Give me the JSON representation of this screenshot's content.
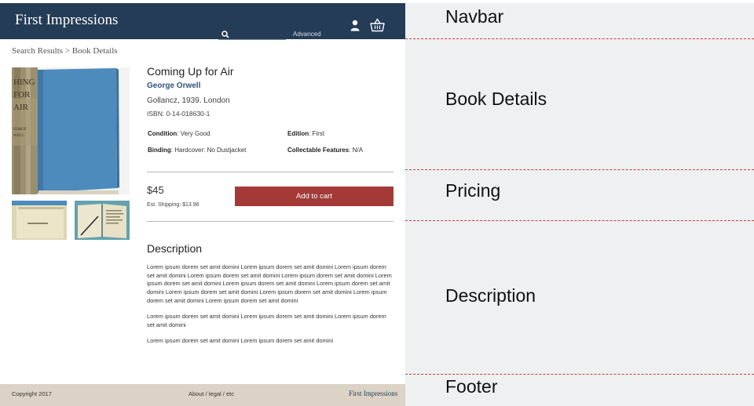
{
  "navbar": {
    "brand": "First Impressions",
    "search_placeholder": "",
    "advanced_label": "Advanced",
    "icons": [
      "search-icon",
      "user-icon",
      "basket-icon"
    ],
    "color": "#243c56"
  },
  "breadcrumb": {
    "parent": "Search Results",
    "separator": " > ",
    "current": "Book Details"
  },
  "book": {
    "title": "Coming Up for Air",
    "author": "George Orwell",
    "publication": "Gollancz, 1939. London",
    "isbn": "ISBN: 0-14-018630-1",
    "attributes": [
      {
        "label": "Condition",
        "value": ": Very Good"
      },
      {
        "label": "Edition",
        "value": ": First"
      },
      {
        "label": "Binding",
        "value": ": Hardcover:  No Dustjacket"
      },
      {
        "label": "Collectable Features",
        "value": ":  N/A"
      }
    ]
  },
  "pricing": {
    "price": "$45",
    "shipping": "Est. Shipping: $13.96",
    "cart_label": "Add to cart",
    "cart_color": "#a33a38"
  },
  "description": {
    "heading": "Description",
    "paragraphs": [
      "Lorem ipsum dorem set amit domini Lorem ipsum dorem set amit domini Lorem ipsum dorem set amit domini Lorem ipsum dorem set amit domini Lorem ipsum dorem set amit domini Lorem ipsum dorem set amit domini Lorem ipsum dorem set amit domini Lorem ipsum dorem set amit domini Lorem ipsum dorem set amit domini Lorem ipsum dorem set amit domini Lorem ipsum dorem set amit domini Lorem ipsum dorem set amit domini",
      "Lorem ipsum dorem set amit domini Lorem ipsum dorem set amit domini Lorem ipsum dorem set amit domini",
      "Lorem ipsum dorem set amit domini Lorem ipsum dorem set amit domini"
    ]
  },
  "footer": {
    "copyright": "Copyright 2017",
    "links": "About / legal / etc",
    "brand": "First Impressions",
    "color": "#dcd3c6"
  },
  "annotations": {
    "navbar": "Navbar",
    "book_details": "Book Details",
    "pricing": "Pricing",
    "description": "Description",
    "footer": "Footer",
    "separator_color": "#cc3b3b"
  }
}
